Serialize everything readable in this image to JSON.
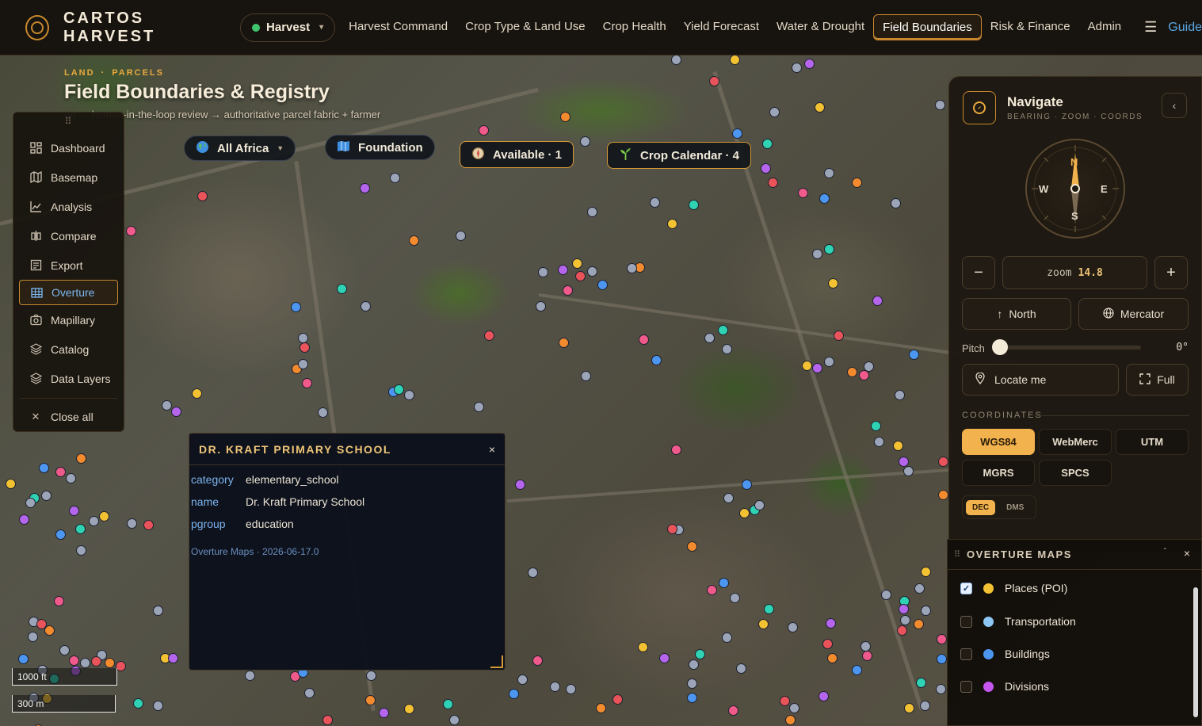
{
  "app": {
    "brand": "CARTOS HARVEST",
    "workspace": "Harvest",
    "nav": [
      {
        "label": "Harvest Command"
      },
      {
        "label": "Crop Type & Land Use"
      },
      {
        "label": "Crop Health"
      },
      {
        "label": "Yield Forecast"
      },
      {
        "label": "Water & Drought"
      },
      {
        "label": "Field Boundaries",
        "active": true
      },
      {
        "label": "Risk & Finance"
      },
      {
        "label": "Admin"
      }
    ],
    "guide": "Guide"
  },
  "page": {
    "eyebrow_1": "LAND",
    "eyebrow_2": "PARCELS",
    "title": "Field Boundaries & Registry",
    "subtitle": "on → human-in-the-loop review → authoritative parcel fabric + farmer"
  },
  "left_menu": {
    "grip": "⠿",
    "items": [
      {
        "label": "Dashboard",
        "icon": "dashboard-icon"
      },
      {
        "label": "Basemap",
        "icon": "map-icon"
      },
      {
        "label": "Analysis",
        "icon": "chart-icon"
      },
      {
        "label": "Compare",
        "icon": "compare-icon"
      },
      {
        "label": "Export",
        "icon": "export-icon"
      },
      {
        "label": "Overture",
        "icon": "grid-icon",
        "active": true
      },
      {
        "label": "Mapillary",
        "icon": "camera-icon"
      },
      {
        "label": "Catalog",
        "icon": "stack-icon"
      },
      {
        "label": "Data Layers",
        "icon": "layers-icon"
      }
    ],
    "close_all": "Close all"
  },
  "chips": {
    "region": "All Africa",
    "foundation": "Foundation",
    "available": "Available · 1",
    "crop_calendar": "Crop Calendar · 4"
  },
  "popup": {
    "title": "DR. KRAFT PRIMARY SCHOOL",
    "close": "×",
    "rows": [
      {
        "key": "category",
        "value": "elementary_school"
      },
      {
        "key": "name",
        "value": "Dr. Kraft Primary School"
      },
      {
        "key": "pgroup",
        "value": "education"
      }
    ],
    "source": "Overture Maps · 2026-06-17.0"
  },
  "scale": {
    "imperial": "1000 ft",
    "metric": "300 m"
  },
  "navigate": {
    "title": "Navigate",
    "subtitle": "BEARING · ZOOM · COORDS",
    "collapse": "‹",
    "compass": {
      "n": "N",
      "s": "S",
      "e": "E",
      "w": "W"
    },
    "zoom_label": "zoom",
    "zoom_value": "14.8",
    "minus": "−",
    "plus": "+",
    "north": "North",
    "projection": "Mercator",
    "pitch_label": "Pitch",
    "pitch_value": "0°",
    "locate": "Locate me",
    "full": "Full",
    "coords_label": "COORDINATES",
    "crs": [
      "WGS84",
      "WebMerc",
      "UTM",
      "MGRS",
      "SPCS"
    ],
    "crs_active": "WGS84",
    "format": [
      "DEC",
      "DMS"
    ],
    "format_active": "DEC"
  },
  "overture": {
    "title": "OVERTURE MAPS",
    "collapse": "ˆ",
    "close": "×",
    "layers": [
      {
        "label": "Places (POI)",
        "checked": true,
        "color": "#f3c232"
      },
      {
        "label": "Transportation",
        "checked": false,
        "color": "#8ec7f5"
      },
      {
        "label": "Buildings",
        "checked": false,
        "color": "#4d96f0"
      },
      {
        "label": "Divisions",
        "checked": false,
        "color": "#c556f0"
      }
    ]
  },
  "poi_colors": {
    "grey": "#9ca5b8",
    "blue": "#4d96f0",
    "orange": "#f28a2e",
    "purple": "#b565ec",
    "teal": "#2fd2b3",
    "pink": "#f05a8a",
    "red": "#e8545a",
    "yellow": "#f3c232"
  }
}
